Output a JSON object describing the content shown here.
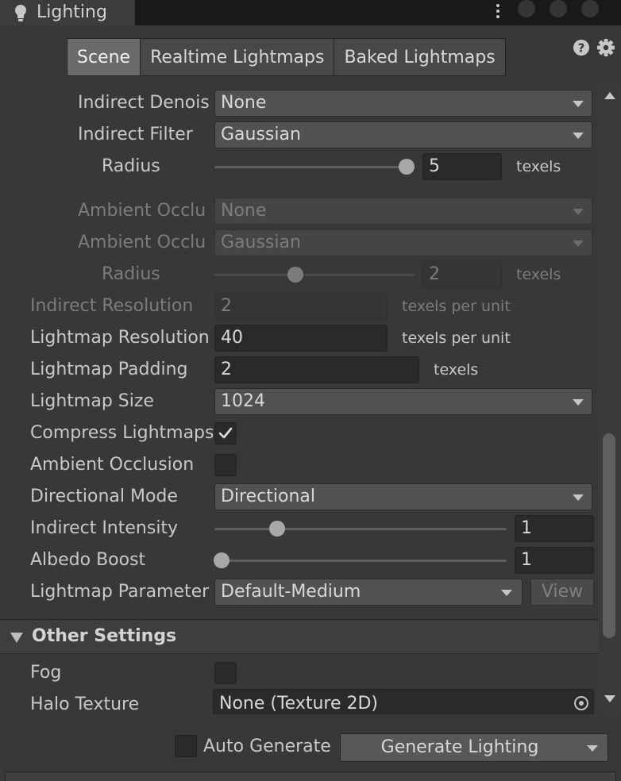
{
  "window": {
    "title": "Lighting"
  },
  "tabs": [
    {
      "label": "Scene",
      "active": true
    },
    {
      "label": "Realtime Lightmaps",
      "active": false
    },
    {
      "label": "Baked Lightmaps",
      "active": false
    }
  ],
  "icons": {
    "bulb": "lightbulb-icon",
    "help": "help-icon",
    "gear": "gear-icon",
    "menu": "kebab-menu-icon"
  },
  "settings": {
    "indirect_denoiser": {
      "label": "Indirect Denois",
      "value": "None"
    },
    "indirect_filter": {
      "label": "Indirect Filter",
      "value": "Gaussian"
    },
    "indirect_radius": {
      "label": "Radius",
      "value": "5",
      "unit": "texels",
      "level": 1.0
    },
    "ao_denoiser": {
      "label": "Ambient Occlu",
      "value": "None",
      "disabled": true
    },
    "ao_filter": {
      "label": "Ambient Occlu",
      "value": "Gaussian",
      "disabled": true
    },
    "ao_radius": {
      "label": "Radius",
      "value": "2",
      "unit": "texels",
      "level": 0.4,
      "disabled": true
    },
    "indirect_resolution": {
      "label": "Indirect Resolution",
      "value": "2",
      "unit": "texels per unit",
      "disabled": true
    },
    "lightmap_resolution": {
      "label": "Lightmap Resolution",
      "value": "40",
      "unit": "texels per unit"
    },
    "lightmap_padding": {
      "label": "Lightmap Padding",
      "value": "2",
      "unit": "texels"
    },
    "lightmap_size": {
      "label": "Lightmap Size",
      "value": "1024"
    },
    "compress_lightmaps": {
      "label": "Compress Lightmaps",
      "checked": true
    },
    "ambient_occlusion": {
      "label": "Ambient Occlusion",
      "checked": false
    },
    "directional_mode": {
      "label": "Directional Mode",
      "value": "Directional"
    },
    "indirect_intensity": {
      "label": "Indirect Intensity",
      "value": "1",
      "level": 0.2
    },
    "albedo_boost": {
      "label": "Albedo Boost",
      "value": "1",
      "level": 0.0
    },
    "lightmap_parameters": {
      "label": "Lightmap Parameter",
      "value": "Default-Medium",
      "view_label": "View"
    }
  },
  "other_settings": {
    "header": "Other Settings",
    "fog": {
      "label": "Fog",
      "checked": false
    },
    "halo_texture": {
      "label": "Halo Texture",
      "value": "None (Texture 2D)"
    }
  },
  "footer": {
    "auto_generate": {
      "label": "Auto Generate",
      "checked": false
    },
    "generate_button": "Generate Lighting"
  }
}
